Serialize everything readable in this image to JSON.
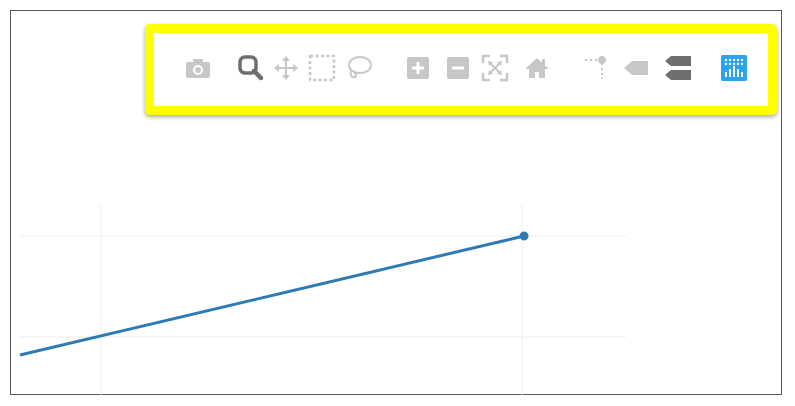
{
  "modebar": {
    "highlight_color": "#ffff00",
    "buttons": [
      {
        "name": "download-plot",
        "icon": "camera-icon",
        "state": "inactive"
      },
      {
        "name": "zoom",
        "icon": "zoom-magnifier-icon",
        "state": "active"
      },
      {
        "name": "pan",
        "icon": "pan-arrows-icon",
        "state": "inactive"
      },
      {
        "name": "box-select",
        "icon": "box-select-icon",
        "state": "inactive"
      },
      {
        "name": "lasso-select",
        "icon": "lasso-icon",
        "state": "inactive"
      },
      {
        "name": "zoom-in",
        "icon": "plus-square-icon",
        "state": "inactive"
      },
      {
        "name": "zoom-out",
        "icon": "minus-square-icon",
        "state": "inactive"
      },
      {
        "name": "autoscale",
        "icon": "autoscale-icon",
        "state": "inactive"
      },
      {
        "name": "reset-axes",
        "icon": "home-icon",
        "state": "inactive"
      },
      {
        "name": "toggle-spike-lines",
        "icon": "spike-lines-icon",
        "state": "inactive"
      },
      {
        "name": "hover-closest",
        "icon": "hover-closest-icon",
        "state": "inactive"
      },
      {
        "name": "hover-compare",
        "icon": "hover-compare-icon",
        "state": "active"
      },
      {
        "name": "plotly-logo",
        "icon": "plotly-logo-icon",
        "state": "brand"
      }
    ],
    "colors": {
      "inactive": "#c7c7c7",
      "active": "#6e6e6e",
      "brand": "#2aa3ef"
    }
  },
  "chart_data": {
    "type": "line",
    "series": [
      {
        "color": "#2e7bb4",
        "marker_at_end": true
      }
    ],
    "grid": true
  }
}
